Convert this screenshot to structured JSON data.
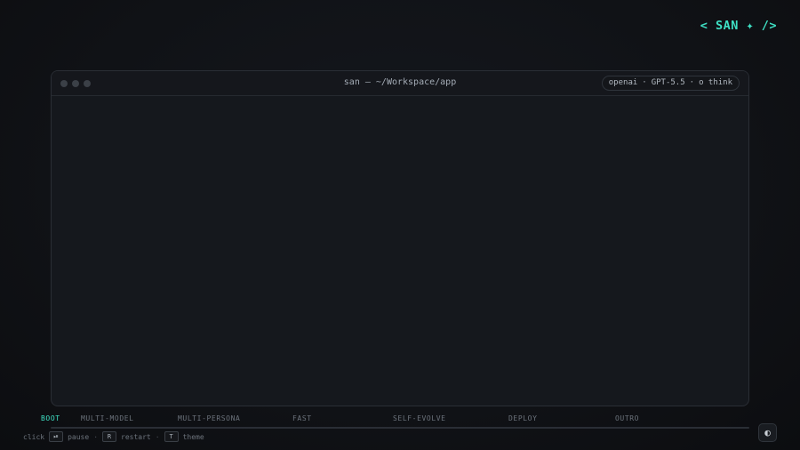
{
  "logo": {
    "text": "< SAN ✦ />"
  },
  "window": {
    "title": "san — ~/Workspace/app",
    "model": {
      "provider": "openai",
      "sep1": "·",
      "name": "GPT-5.5",
      "sep2": "·",
      "mode": "o think"
    }
  },
  "steps": [
    {
      "label": "BOOT",
      "active": true
    },
    {
      "label": "MULTI-MODEL",
      "active": false
    },
    {
      "label": "MULTI-PERSONA",
      "active": false
    },
    {
      "label": "FAST",
      "active": false
    },
    {
      "label": "SELF-EVOLVE",
      "active": false
    },
    {
      "label": "DEPLOY",
      "active": false
    },
    {
      "label": "OUTRO",
      "active": false
    }
  ],
  "progress": {
    "fraction": 0.0
  },
  "hints": {
    "click": "click",
    "pause_key": "⏯",
    "pause": "pause",
    "sep": "·",
    "restart_key": "R",
    "restart": "restart",
    "theme_key": "T",
    "theme": "theme"
  },
  "theme_button": {
    "icon": "half-circle-icon",
    "glyph": "◐"
  },
  "colors": {
    "accent": "#3ee0c4",
    "background": "#101216",
    "window": "#15181d"
  }
}
